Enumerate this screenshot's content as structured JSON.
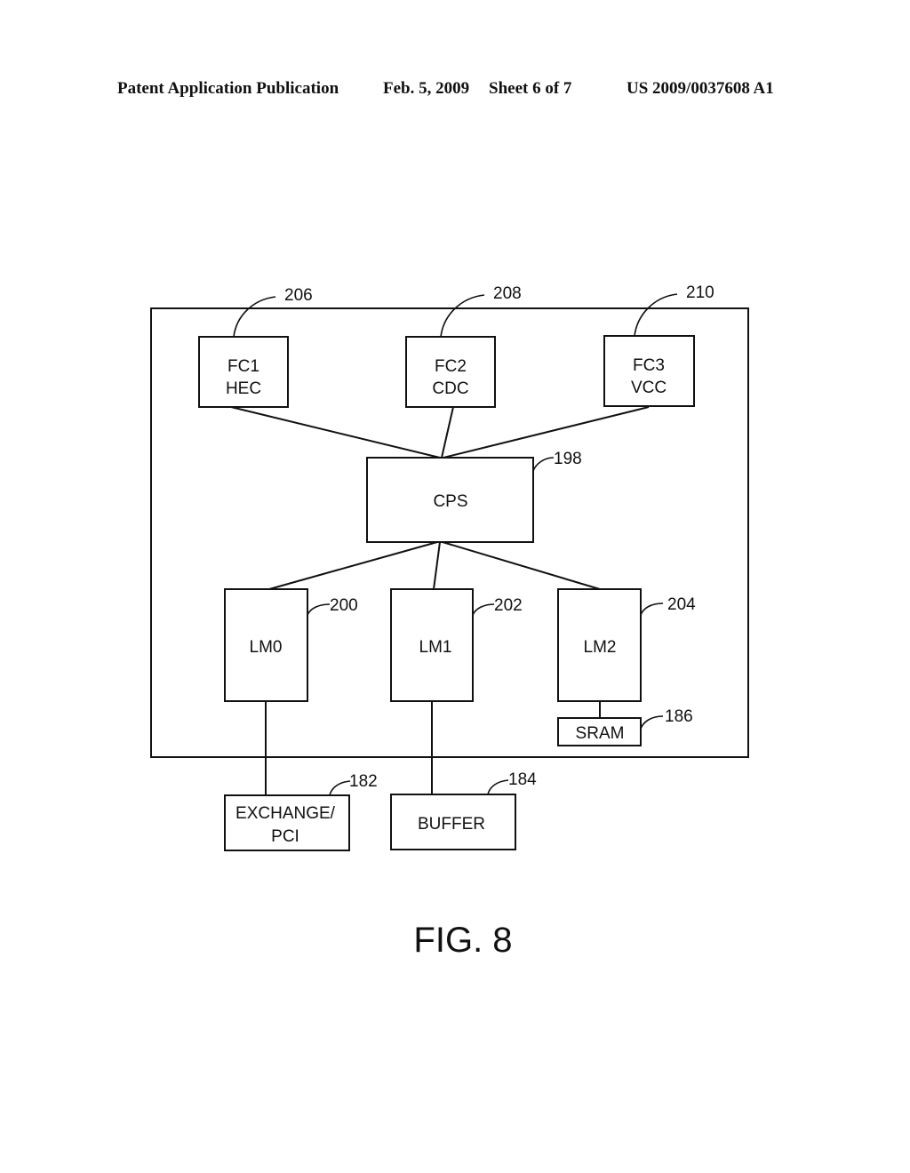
{
  "header": {
    "publication": "Patent Application Publication",
    "date": "Feb. 5, 2009",
    "sheet": "Sheet 6 of 7",
    "number": "US 2009/0037608 A1"
  },
  "figure": {
    "caption": "FIG. 8",
    "blocks": {
      "fc1": {
        "line1": "FC1",
        "line2": "HEC",
        "ref": "206"
      },
      "fc2": {
        "line1": "FC2",
        "line2": "CDC",
        "ref": "208"
      },
      "fc3": {
        "line1": "FC3",
        "line2": "VCC",
        "ref": "210"
      },
      "cps": {
        "label": "CPS",
        "ref": "198"
      },
      "lm0": {
        "label": "LM0",
        "ref": "200"
      },
      "lm1": {
        "label": "LM1",
        "ref": "202"
      },
      "lm2": {
        "label": "LM2",
        "ref": "204"
      },
      "sram": {
        "label": "SRAM",
        "ref": "186"
      },
      "exchange": {
        "line1": "EXCHANGE/",
        "line2": "PCI",
        "ref": "182"
      },
      "buffer": {
        "label": "BUFFER",
        "ref": "184"
      }
    }
  }
}
